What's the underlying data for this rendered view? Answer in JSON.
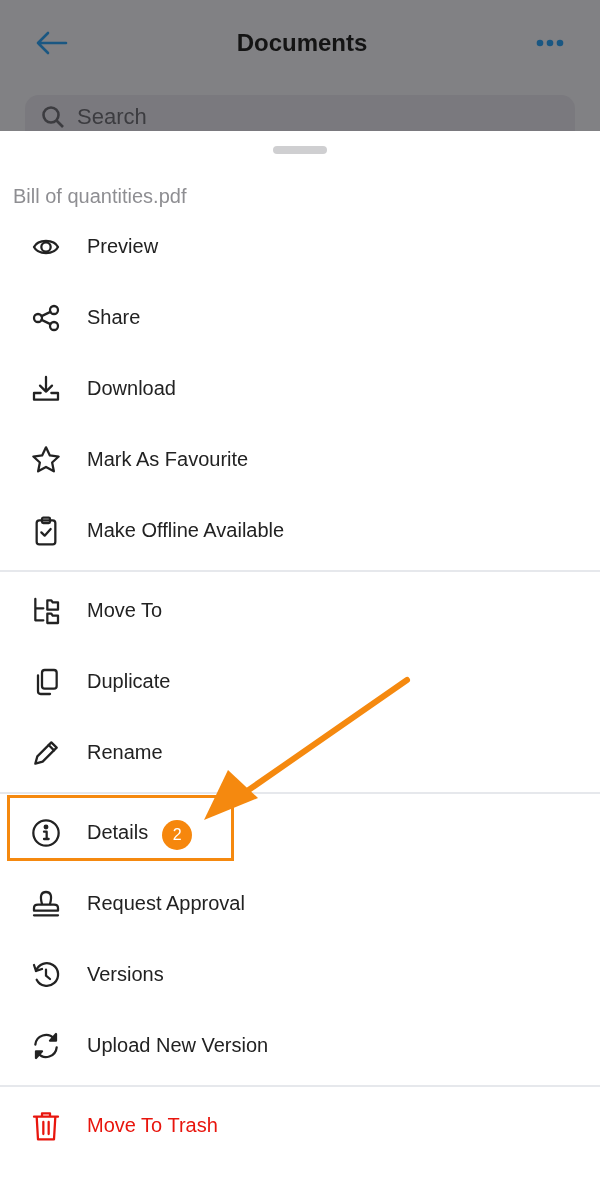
{
  "header": {
    "title": "Documents",
    "search": {
      "placeholder": "Search"
    }
  },
  "sheet": {
    "file_name": "Bill of quantities.pdf",
    "groups": [
      {
        "items": [
          {
            "label": "Preview",
            "kind": "normal",
            "highlighted": false
          },
          {
            "label": "Share",
            "kind": "normal",
            "highlighted": false
          },
          {
            "label": "Download",
            "kind": "normal",
            "highlighted": false
          },
          {
            "label": "Mark As Favourite",
            "kind": "normal",
            "highlighted": false
          },
          {
            "label": "Make Offline Available",
            "kind": "normal",
            "highlighted": false
          }
        ]
      },
      {
        "items": [
          {
            "label": "Move To",
            "kind": "normal",
            "highlighted": false
          },
          {
            "label": "Duplicate",
            "kind": "normal",
            "highlighted": false
          },
          {
            "label": "Rename",
            "kind": "normal",
            "highlighted": false
          }
        ]
      },
      {
        "items": [
          {
            "label": "Details",
            "kind": "normal",
            "highlighted": true,
            "badge": "2"
          },
          {
            "label": "Request Approval",
            "kind": "normal",
            "highlighted": false
          },
          {
            "label": "Versions",
            "kind": "normal",
            "highlighted": false
          },
          {
            "label": "Upload New Version",
            "kind": "normal",
            "highlighted": false
          }
        ]
      },
      {
        "items": [
          {
            "label": "Move To Trash",
            "kind": "danger",
            "highlighted": false
          }
        ]
      }
    ]
  }
}
